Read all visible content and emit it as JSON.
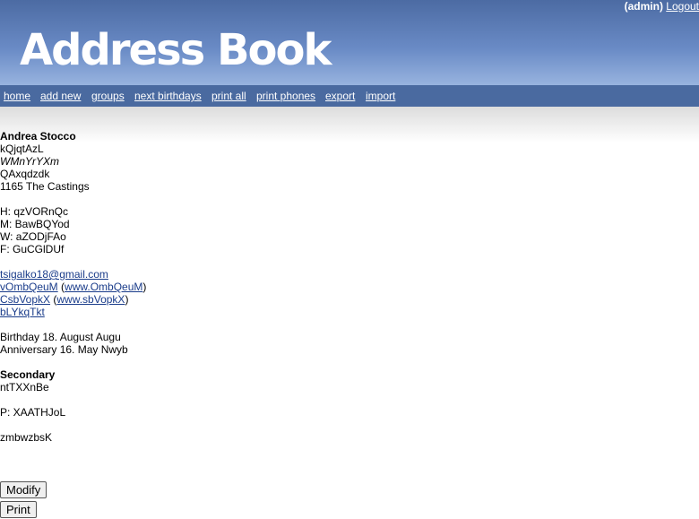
{
  "header": {
    "user": "(admin)",
    "logout_label": "Logout",
    "logo_text": "Address Book"
  },
  "nav": {
    "home": "home",
    "add_new": "add new",
    "groups": "groups",
    "next_birthdays": "next birthdays",
    "print_all": "print all",
    "print_phones": "print phones",
    "export": "export",
    "import": "import"
  },
  "contact": {
    "name": "Andrea Stocco",
    "nickname": "kQjqtAzL",
    "title": "WMnYrYXm",
    "company": "QAxqdzdk",
    "address": "1165 The Castings",
    "phone_home": "H: qzVORnQc",
    "phone_mobile": "M: BawBQYod",
    "phone_work": "W: aZODjFAo",
    "fax": "F: GuCGlDUf",
    "email": "tsigalko18@gmail.com",
    "link1_label": "vOmbQeuM",
    "link1_url": "www.OmbQeuM",
    "link2_label": "CsbVopkX",
    "link2_url": "www.sbVopkX",
    "link3_label": "bLYkqTkt",
    "birthday": "Birthday 18. August Augu",
    "anniversary": "Anniversary 16. May Nwyb",
    "secondary_heading": "Secondary",
    "secondary_address": "ntTXXnBe",
    "secondary_phone": "P: XAATHJoL",
    "notes": "zmbwzbsK"
  },
  "buttons": {
    "modify": "Modify",
    "print": "Print"
  }
}
